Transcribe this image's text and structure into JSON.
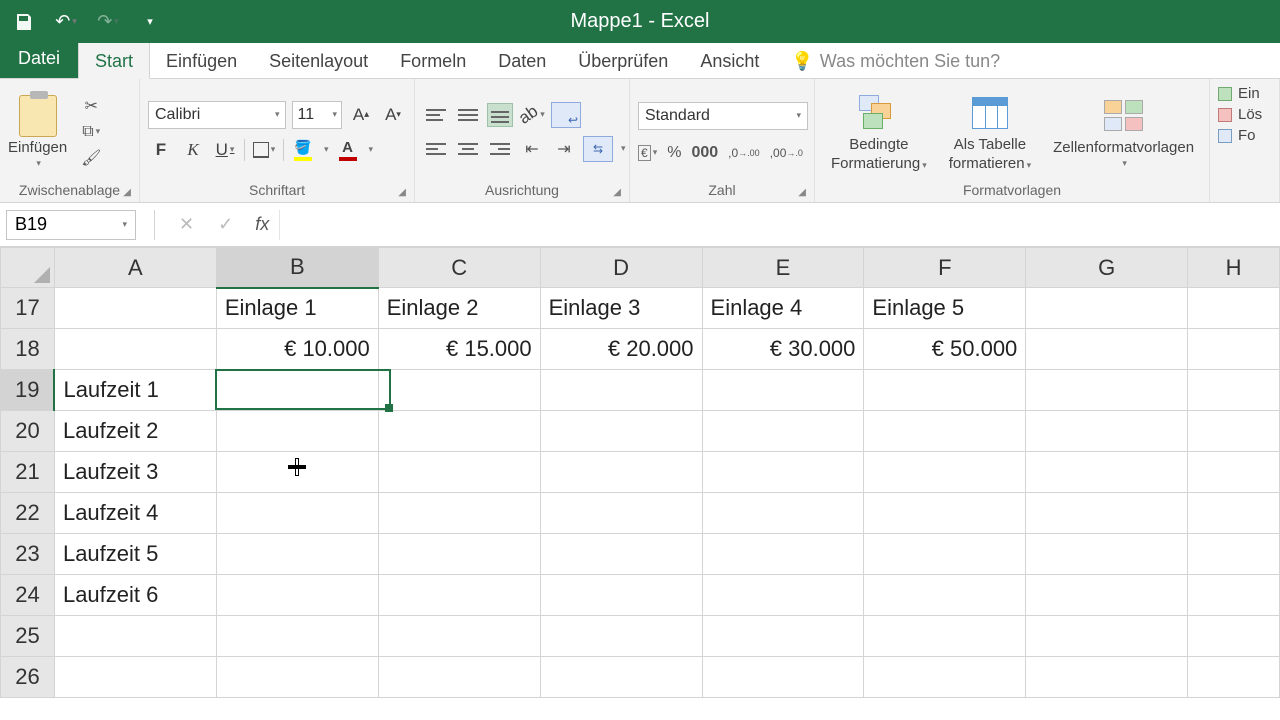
{
  "title": "Mappe1 - Excel",
  "tabs": {
    "file": "Datei",
    "home": "Start",
    "insert": "Einfügen",
    "pagelayout": "Seitenlayout",
    "formulas": "Formeln",
    "data": "Daten",
    "review": "Überprüfen",
    "view": "Ansicht",
    "tellme": "Was möchten Sie tun?"
  },
  "ribbon": {
    "clipboard": {
      "label": "Zwischenablage",
      "paste": "Einfügen"
    },
    "font": {
      "label": "Schriftart",
      "name": "Calibri",
      "size": "11"
    },
    "alignment": {
      "label": "Ausrichtung"
    },
    "number": {
      "label": "Zahl",
      "format": "Standard"
    },
    "styles": {
      "label": "Formatvorlagen",
      "cond1": "Bedingte",
      "cond2": "Formatierung",
      "table1": "Als Tabelle",
      "table2": "formatieren",
      "cellstyles": "Zellenformatvorlagen"
    },
    "cells": {
      "insert": "Ein",
      "delete": "Lös",
      "format": "Fo"
    }
  },
  "formula_bar": {
    "name_box": "B19",
    "formula": ""
  },
  "columns": [
    "A",
    "B",
    "C",
    "D",
    "E",
    "F",
    "G",
    "H"
  ],
  "rows": [
    {
      "n": 17,
      "A": "",
      "B": "Einlage 1",
      "C": "Einlage 2",
      "D": "Einlage 3",
      "E": "Einlage 4",
      "F": "Einlage 5"
    },
    {
      "n": 18,
      "A": "",
      "B": "€ 10.000",
      "C": "€ 15.000",
      "D": "€ 20.000",
      "E": "€ 30.000",
      "F": "€ 50.000"
    },
    {
      "n": 19,
      "A": "Laufzeit 1"
    },
    {
      "n": 20,
      "A": "Laufzeit 2"
    },
    {
      "n": 21,
      "A": "Laufzeit 3"
    },
    {
      "n": 22,
      "A": "Laufzeit 4"
    },
    {
      "n": 23,
      "A": "Laufzeit 5"
    },
    {
      "n": 24,
      "A": "Laufzeit 6"
    },
    {
      "n": 25,
      "A": ""
    },
    {
      "n": 26,
      "A": ""
    }
  ],
  "selected_cell": "B19"
}
